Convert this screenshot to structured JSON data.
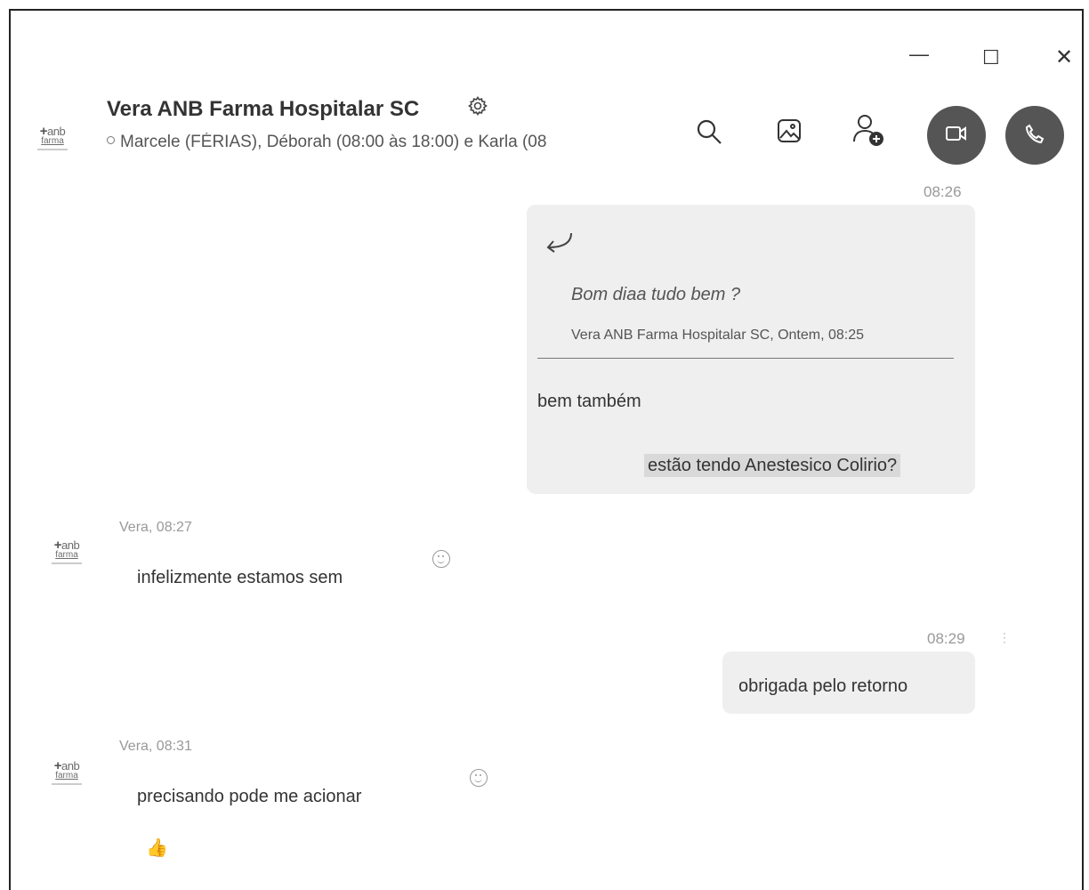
{
  "window": {
    "minimize": "—",
    "maximize": "☐",
    "close": "✕"
  },
  "header": {
    "title": "Vera ANB Farma Hospitalar SC",
    "subtitle": "Marcele (FÉRIAS), Déborah (08:00 às 18:00) e Karla (08",
    "logo": {
      "line1": "anb",
      "line2": "farma"
    }
  },
  "messages": {
    "m1": {
      "time": "08:26",
      "quote_text": "Bom diaa tudo bem ?",
      "quote_meta": "Vera ANB Farma Hospitalar SC, Ontem, 08:25",
      "reply_text": "bem também",
      "second_text": "estão tendo Anestesico Colirio?"
    },
    "m2": {
      "sender_time": "Vera, 08:27",
      "text": "infelizmente estamos sem"
    },
    "m3": {
      "time": "08:29",
      "text": "obrigada pelo retorno"
    },
    "m4": {
      "sender_time": "Vera, 08:31",
      "text": "precisando pode me acionar"
    }
  },
  "colors": {
    "call_button": "#555555",
    "my_bubble": "#efefef"
  },
  "icons": {
    "settings": "gear-icon",
    "search": "search-icon",
    "gallery": "image-icon",
    "add_people": "add-person-icon",
    "video": "video-camera-icon",
    "call": "phone-icon",
    "reply": "reply-arrow-icon",
    "reaction": "smiley-icon",
    "like": "thumbs-up-icon"
  }
}
